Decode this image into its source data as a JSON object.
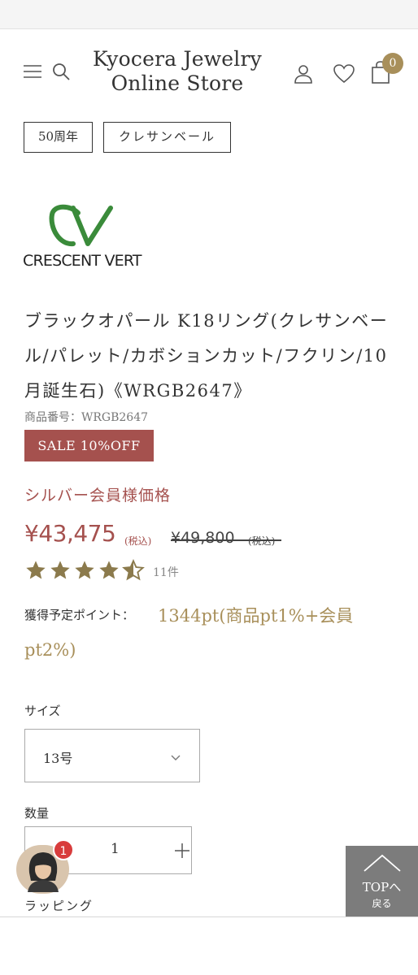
{
  "header": {
    "store_name_line1": "Kyocera Jewelry",
    "store_name_line2": "Online Store",
    "cart_count": "0"
  },
  "tags": [
    "50周年",
    "クレサンベール"
  ],
  "brand": {
    "name": "CRESCENT VERT",
    "logo_color": "#3a8b3a"
  },
  "product": {
    "title": "ブラックオパール K18リング(クレサンベール/パレット/カボションカット/フクリン/10月誕生石)《WRGB2647》",
    "code": "商品番号：WRGB2647",
    "sale_badge": "SALE 10%OFF",
    "member_label": "シルバー会員様価格",
    "price": "¥43,475",
    "price_tax": "(税込)",
    "old_price": "¥49,800",
    "old_price_tax": "(税込)",
    "rating": 4.5,
    "review_count": "11件",
    "points_label": "獲得予定ポイント：",
    "points_value": "1344pt(商品pt1%+会員pt2%)"
  },
  "options": {
    "size_label": "サイズ",
    "size_value": "13号",
    "qty_label": "数量",
    "qty_value": "1",
    "wrapping_label": "ラッピング"
  },
  "chat": {
    "badge": "1"
  },
  "top_button": {
    "label": "TOPへ",
    "sub": "戻る"
  },
  "colors": {
    "accent": "#a5514e",
    "gold": "#a88f5a",
    "star": "#8b7a4c"
  }
}
